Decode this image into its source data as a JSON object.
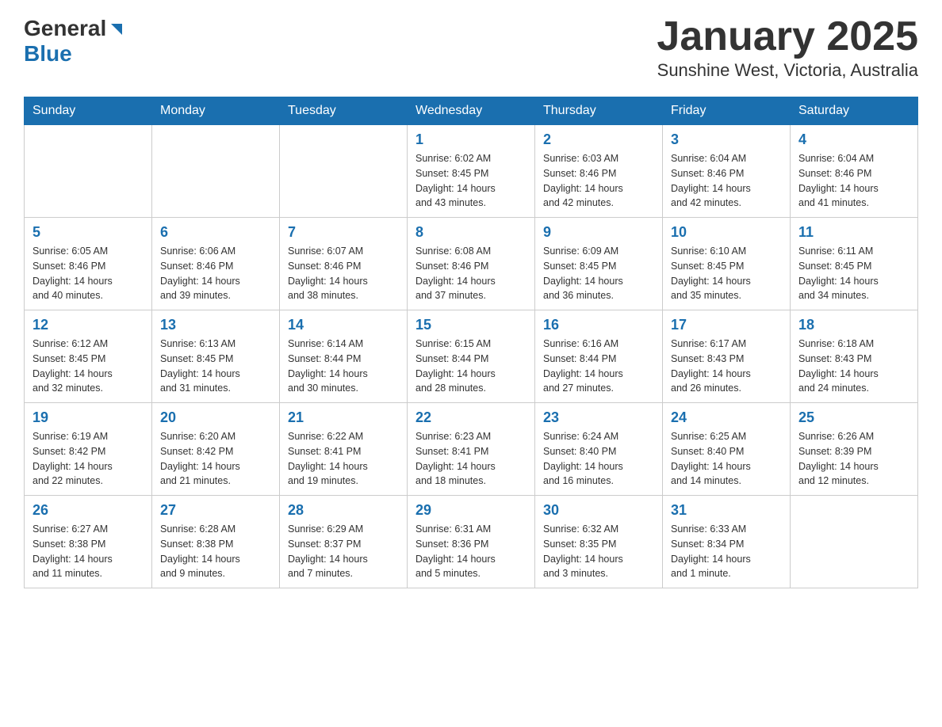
{
  "header": {
    "logo_line1": "General",
    "logo_line2": "Blue",
    "month_title": "January 2025",
    "subtitle": "Sunshine West, Victoria, Australia"
  },
  "calendar": {
    "headers": [
      "Sunday",
      "Monday",
      "Tuesday",
      "Wednesday",
      "Thursday",
      "Friday",
      "Saturday"
    ],
    "weeks": [
      [
        {
          "day": "",
          "info": ""
        },
        {
          "day": "",
          "info": ""
        },
        {
          "day": "",
          "info": ""
        },
        {
          "day": "1",
          "info": "Sunrise: 6:02 AM\nSunset: 8:45 PM\nDaylight: 14 hours\nand 43 minutes."
        },
        {
          "day": "2",
          "info": "Sunrise: 6:03 AM\nSunset: 8:46 PM\nDaylight: 14 hours\nand 42 minutes."
        },
        {
          "day": "3",
          "info": "Sunrise: 6:04 AM\nSunset: 8:46 PM\nDaylight: 14 hours\nand 42 minutes."
        },
        {
          "day": "4",
          "info": "Sunrise: 6:04 AM\nSunset: 8:46 PM\nDaylight: 14 hours\nand 41 minutes."
        }
      ],
      [
        {
          "day": "5",
          "info": "Sunrise: 6:05 AM\nSunset: 8:46 PM\nDaylight: 14 hours\nand 40 minutes."
        },
        {
          "day": "6",
          "info": "Sunrise: 6:06 AM\nSunset: 8:46 PM\nDaylight: 14 hours\nand 39 minutes."
        },
        {
          "day": "7",
          "info": "Sunrise: 6:07 AM\nSunset: 8:46 PM\nDaylight: 14 hours\nand 38 minutes."
        },
        {
          "day": "8",
          "info": "Sunrise: 6:08 AM\nSunset: 8:46 PM\nDaylight: 14 hours\nand 37 minutes."
        },
        {
          "day": "9",
          "info": "Sunrise: 6:09 AM\nSunset: 8:45 PM\nDaylight: 14 hours\nand 36 minutes."
        },
        {
          "day": "10",
          "info": "Sunrise: 6:10 AM\nSunset: 8:45 PM\nDaylight: 14 hours\nand 35 minutes."
        },
        {
          "day": "11",
          "info": "Sunrise: 6:11 AM\nSunset: 8:45 PM\nDaylight: 14 hours\nand 34 minutes."
        }
      ],
      [
        {
          "day": "12",
          "info": "Sunrise: 6:12 AM\nSunset: 8:45 PM\nDaylight: 14 hours\nand 32 minutes."
        },
        {
          "day": "13",
          "info": "Sunrise: 6:13 AM\nSunset: 8:45 PM\nDaylight: 14 hours\nand 31 minutes."
        },
        {
          "day": "14",
          "info": "Sunrise: 6:14 AM\nSunset: 8:44 PM\nDaylight: 14 hours\nand 30 minutes."
        },
        {
          "day": "15",
          "info": "Sunrise: 6:15 AM\nSunset: 8:44 PM\nDaylight: 14 hours\nand 28 minutes."
        },
        {
          "day": "16",
          "info": "Sunrise: 6:16 AM\nSunset: 8:44 PM\nDaylight: 14 hours\nand 27 minutes."
        },
        {
          "day": "17",
          "info": "Sunrise: 6:17 AM\nSunset: 8:43 PM\nDaylight: 14 hours\nand 26 minutes."
        },
        {
          "day": "18",
          "info": "Sunrise: 6:18 AM\nSunset: 8:43 PM\nDaylight: 14 hours\nand 24 minutes."
        }
      ],
      [
        {
          "day": "19",
          "info": "Sunrise: 6:19 AM\nSunset: 8:42 PM\nDaylight: 14 hours\nand 22 minutes."
        },
        {
          "day": "20",
          "info": "Sunrise: 6:20 AM\nSunset: 8:42 PM\nDaylight: 14 hours\nand 21 minutes."
        },
        {
          "day": "21",
          "info": "Sunrise: 6:22 AM\nSunset: 8:41 PM\nDaylight: 14 hours\nand 19 minutes."
        },
        {
          "day": "22",
          "info": "Sunrise: 6:23 AM\nSunset: 8:41 PM\nDaylight: 14 hours\nand 18 minutes."
        },
        {
          "day": "23",
          "info": "Sunrise: 6:24 AM\nSunset: 8:40 PM\nDaylight: 14 hours\nand 16 minutes."
        },
        {
          "day": "24",
          "info": "Sunrise: 6:25 AM\nSunset: 8:40 PM\nDaylight: 14 hours\nand 14 minutes."
        },
        {
          "day": "25",
          "info": "Sunrise: 6:26 AM\nSunset: 8:39 PM\nDaylight: 14 hours\nand 12 minutes."
        }
      ],
      [
        {
          "day": "26",
          "info": "Sunrise: 6:27 AM\nSunset: 8:38 PM\nDaylight: 14 hours\nand 11 minutes."
        },
        {
          "day": "27",
          "info": "Sunrise: 6:28 AM\nSunset: 8:38 PM\nDaylight: 14 hours\nand 9 minutes."
        },
        {
          "day": "28",
          "info": "Sunrise: 6:29 AM\nSunset: 8:37 PM\nDaylight: 14 hours\nand 7 minutes."
        },
        {
          "day": "29",
          "info": "Sunrise: 6:31 AM\nSunset: 8:36 PM\nDaylight: 14 hours\nand 5 minutes."
        },
        {
          "day": "30",
          "info": "Sunrise: 6:32 AM\nSunset: 8:35 PM\nDaylight: 14 hours\nand 3 minutes."
        },
        {
          "day": "31",
          "info": "Sunrise: 6:33 AM\nSunset: 8:34 PM\nDaylight: 14 hours\nand 1 minute."
        },
        {
          "day": "",
          "info": ""
        }
      ]
    ]
  }
}
